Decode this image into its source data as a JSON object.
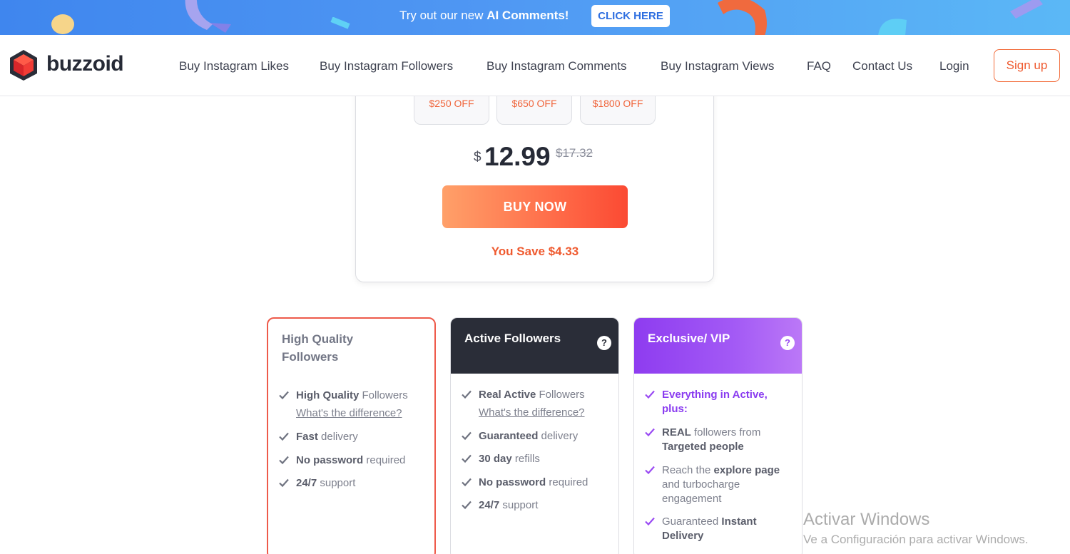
{
  "promo": {
    "text_pre": "Try out our new ",
    "text_bold": "AI Comments!",
    "button": "CLICK HERE",
    "colors": {
      "background": "#4f97f3",
      "button_text": "#2f6fe0"
    }
  },
  "header": {
    "brand": "buzzoid",
    "nav": [
      "Buy Instagram Likes",
      "Buy Instagram Followers",
      "Buy Instagram Comments",
      "Buy Instagram Views",
      "FAQ",
      "Contact Us",
      "Login"
    ],
    "signup": "Sign up",
    "accent": "#ef5a2f"
  },
  "product": {
    "discounts": [
      "$250 OFF",
      "$650 OFF",
      "$1800 OFF"
    ],
    "currency": "$",
    "price": "12.99",
    "old_price": "$17.32",
    "buy_label": "BUY NOW",
    "savings": "You Save $4.33"
  },
  "tiers": [
    {
      "title": "High Quality Followers",
      "has_help": false,
      "features": [
        {
          "bold": "High Quality",
          "rest": " Followers",
          "link": "What's the difference?"
        },
        {
          "bold": "Fast",
          "rest": " delivery"
        },
        {
          "bold": "No password",
          "rest": " required"
        },
        {
          "bold": "24/7",
          "rest": " support"
        }
      ]
    },
    {
      "title": "Active Followers",
      "has_help": true,
      "help": "?",
      "features": [
        {
          "bold": "Real Active",
          "rest": " Followers",
          "link": "What's the difference?"
        },
        {
          "bold": "Guaranteed",
          "rest": " delivery"
        },
        {
          "bold": "30 day",
          "rest": " refills"
        },
        {
          "bold": "No password",
          "rest": " required"
        },
        {
          "bold": "24/7",
          "rest": " support"
        }
      ]
    },
    {
      "title": "Exclusive/ VIP",
      "has_help": true,
      "help": "?",
      "features": [
        {
          "highlight": "Everything in Active, plus:"
        },
        {
          "bold": "REAL",
          "rest": " followers from ",
          "bold2": "Targeted people"
        },
        {
          "pre": "Reach the ",
          "bold": "explore page",
          "rest": " and turbocharge engagement"
        },
        {
          "pre": "Guaranteed ",
          "bold": "Instant Delivery"
        }
      ]
    }
  ],
  "watermark": {
    "line1": "Activar Windows",
    "line2": "Ve a Configuración para activar Windows."
  }
}
